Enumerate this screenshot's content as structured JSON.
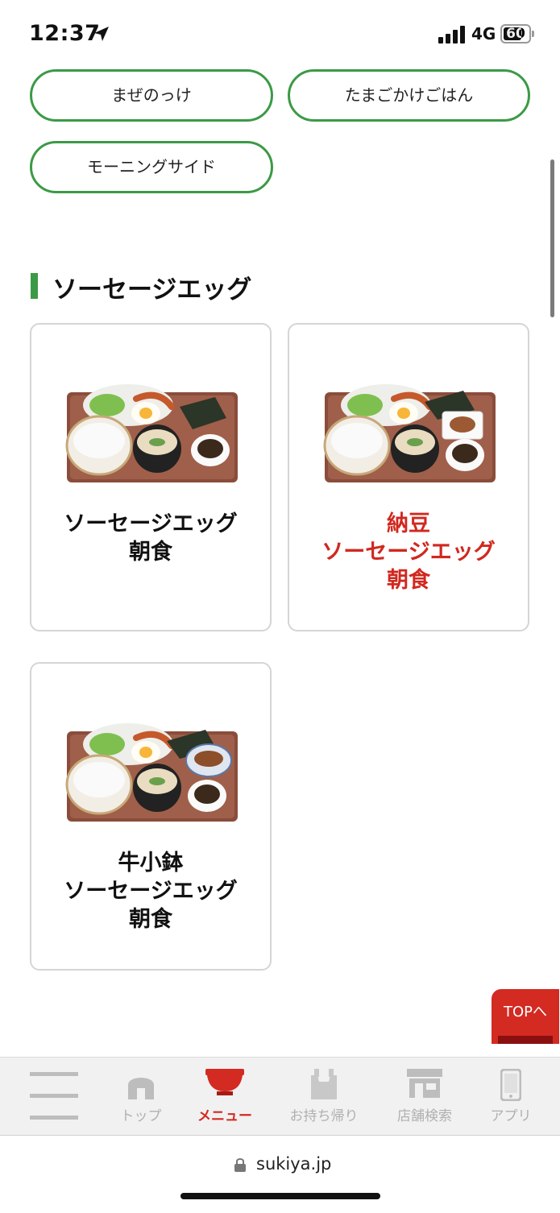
{
  "status_bar": {
    "time": "12:37",
    "network": "4G",
    "battery": "60",
    "icons": [
      "location-arrow-icon",
      "signal-icon",
      "battery-icon"
    ]
  },
  "categories": {
    "pills": [
      {
        "label": "まぜのっけ"
      },
      {
        "label": "たまごかけごはん"
      },
      {
        "label": "モーニングサイド"
      }
    ]
  },
  "section": {
    "title": "ソーセージエッグ",
    "accent_color": "#3b9a45"
  },
  "cards": [
    {
      "lines": [
        "ソーセージエッグ",
        "朝食"
      ],
      "highlight": false,
      "image": "breakfast-tray-sausage-egg"
    },
    {
      "lines": [
        "納豆",
        "ソーセージエッグ",
        "朝食"
      ],
      "highlight": true,
      "image": "breakfast-tray-natto"
    },
    {
      "lines": [
        "牛小鉢",
        "ソーセージエッグ",
        "朝食"
      ],
      "highlight": false,
      "image": "breakfast-tray-beef-bowl"
    }
  ],
  "top_button": {
    "label": "TOPへ",
    "color": "#d32a22"
  },
  "bottom_nav": {
    "items": [
      {
        "label": "",
        "icon": "hamburger-menu-icon"
      },
      {
        "label": "トップ",
        "icon": "home-icon"
      },
      {
        "label": "メニュー",
        "icon": "bowl-icon",
        "active": true
      },
      {
        "label": "お持ち帰り",
        "icon": "takeout-bag-icon"
      },
      {
        "label": "店舗検索",
        "icon": "store-icon"
      },
      {
        "label": "アプリ",
        "icon": "smartphone-icon"
      }
    ],
    "active_color": "#d32a22"
  },
  "browser": {
    "url": "sukiya.jp"
  }
}
